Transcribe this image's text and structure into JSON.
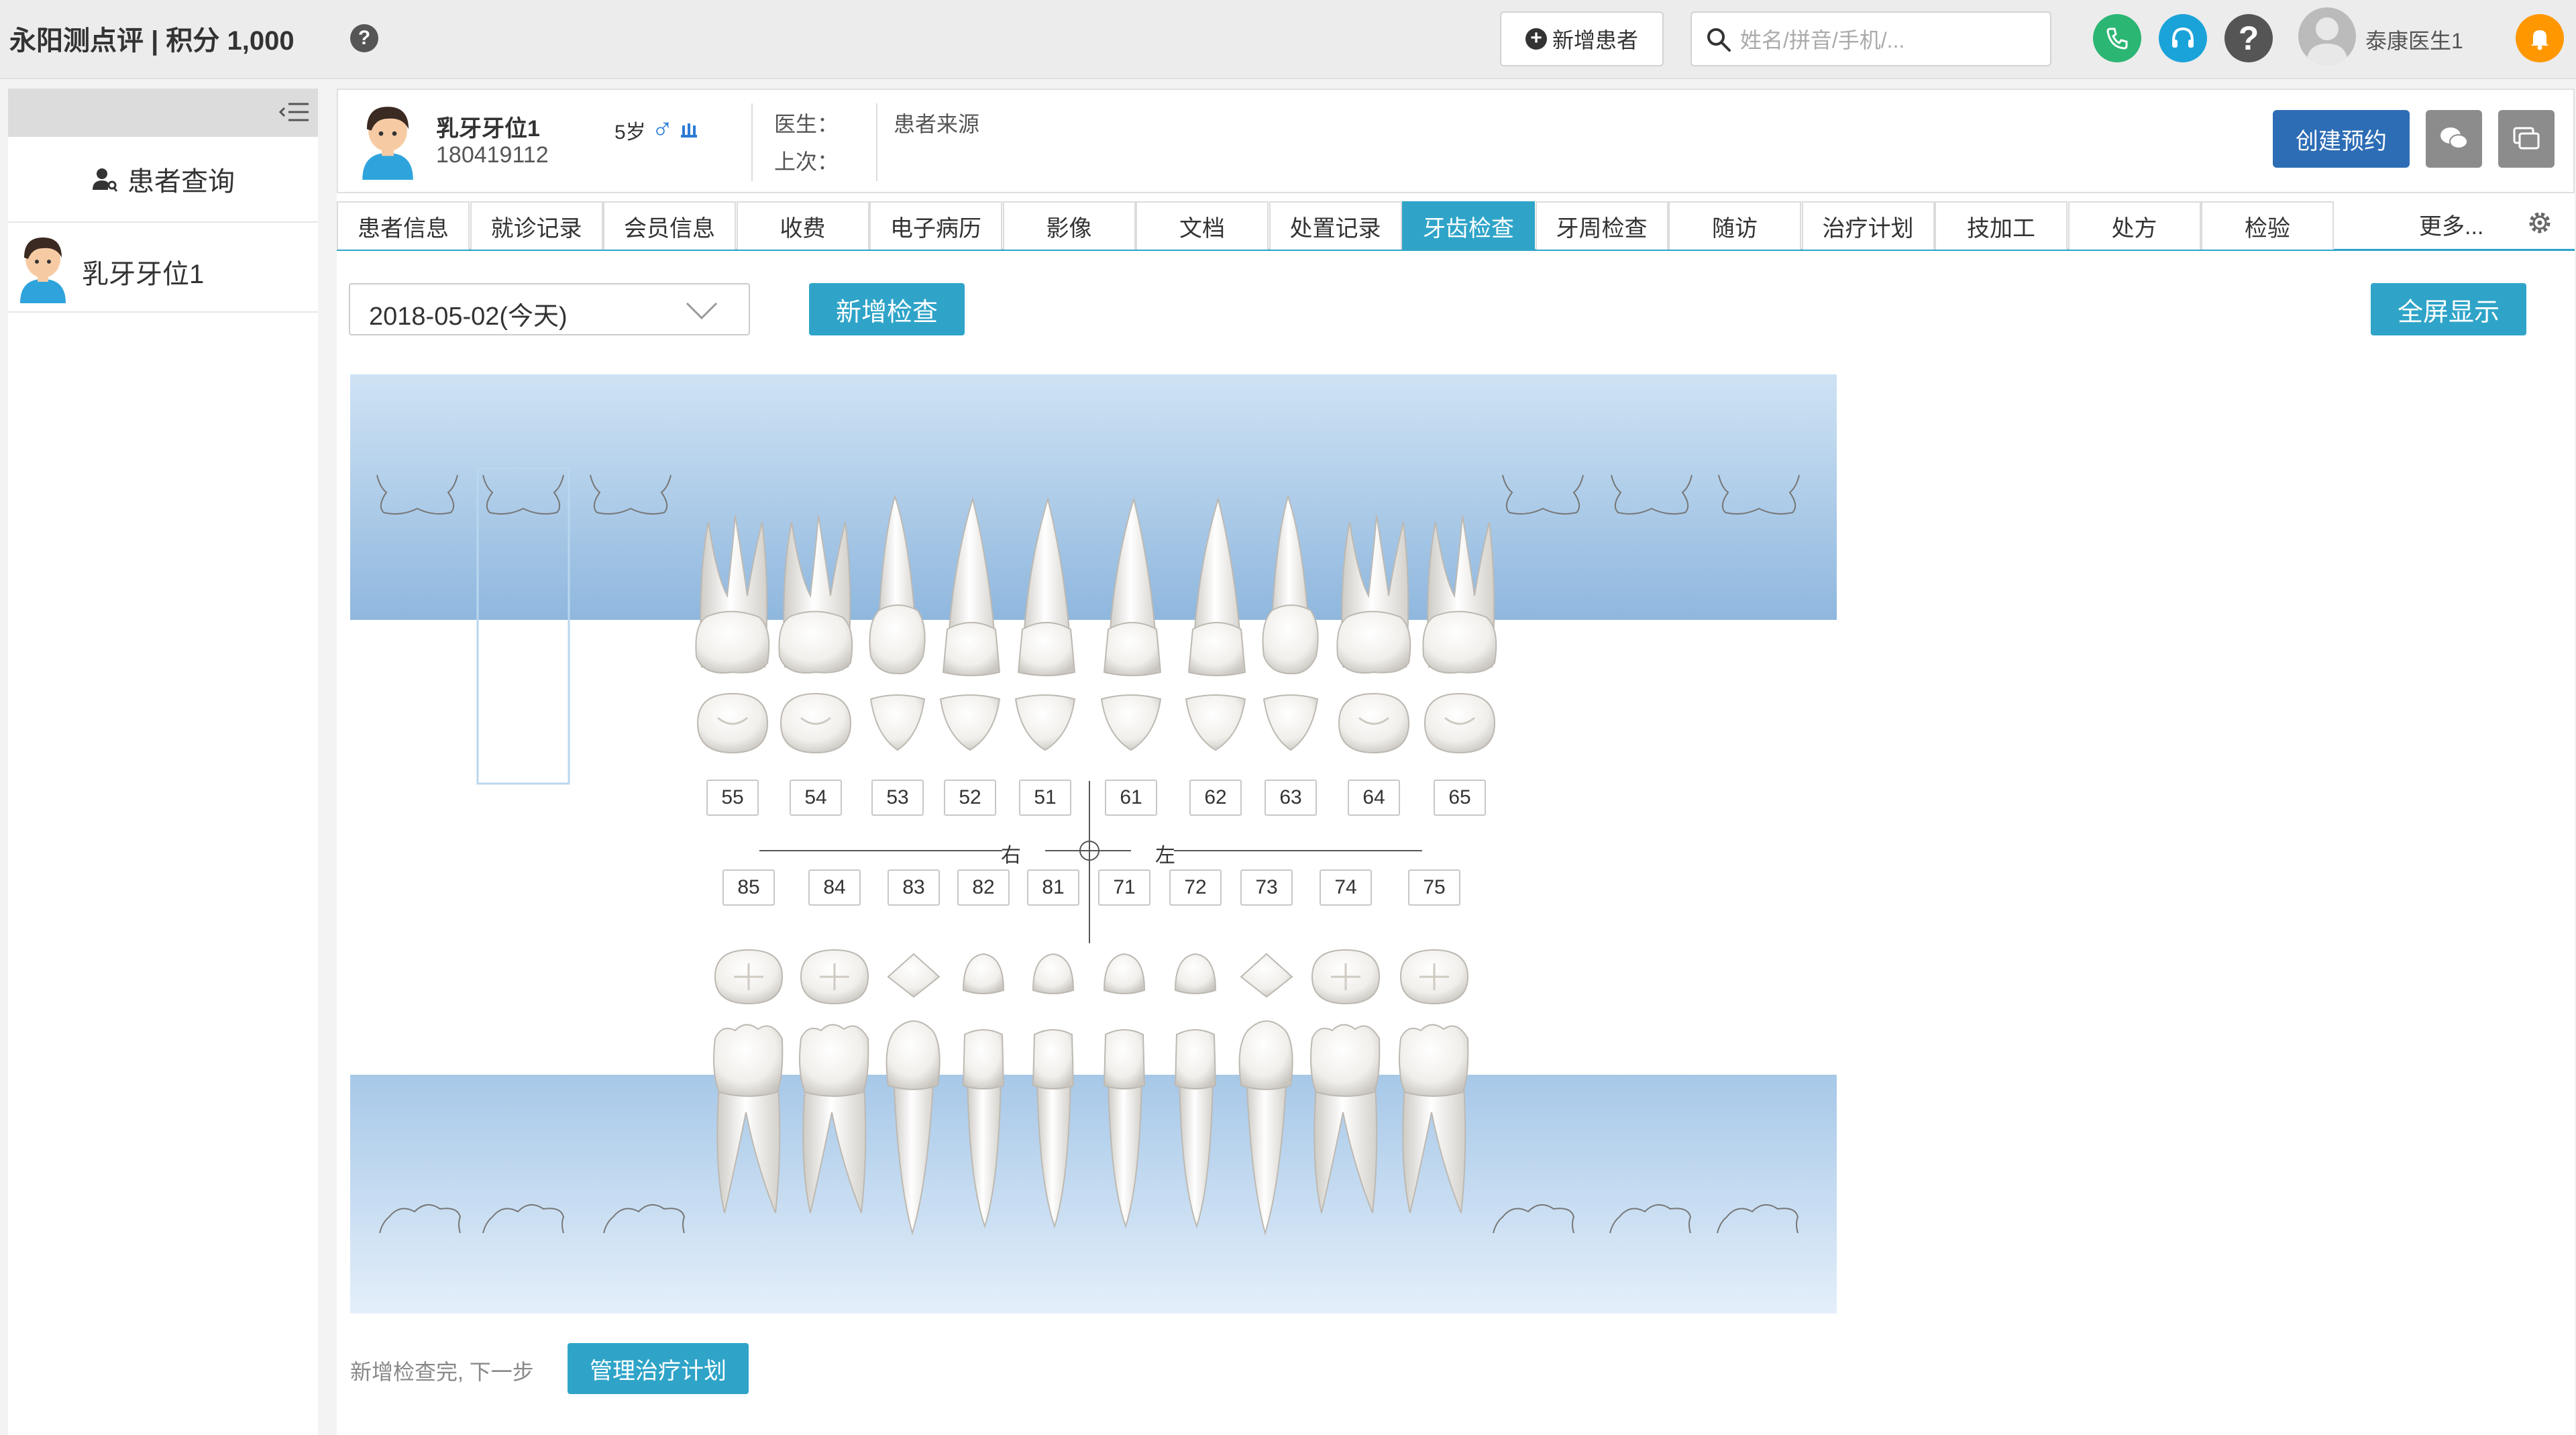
{
  "topbar": {
    "app_title": "永阳测点评 | 积分 1,000",
    "new_patient_label": "新增患者",
    "search_placeholder": "姓名/拼音/手机/...",
    "user_name": "泰康医生1"
  },
  "sidebar": {
    "patient_query_label": "患者查询",
    "patient_name": "乳牙牙位1"
  },
  "patient": {
    "name": "乳牙牙位1",
    "id": "180419112",
    "age": "5岁",
    "doctor_label": "医生：",
    "last_visit_label": "上次：",
    "source_label": "患者来源",
    "create_appointment_label": "创建预约"
  },
  "tabs": [
    {
      "label": "患者信息"
    },
    {
      "label": "就诊记录"
    },
    {
      "label": "会员信息"
    },
    {
      "label": "收费"
    },
    {
      "label": "电子病历"
    },
    {
      "label": "影像"
    },
    {
      "label": "文档"
    },
    {
      "label": "处置记录"
    },
    {
      "label": "牙齿检查",
      "active": true
    },
    {
      "label": "牙周检查"
    },
    {
      "label": "随访"
    },
    {
      "label": "治疗计划"
    },
    {
      "label": "技加工"
    },
    {
      "label": "处方"
    },
    {
      "label": "检验"
    }
  ],
  "more_label": "更多...",
  "exam": {
    "date_value": "2018-05-02(今天)",
    "new_exam_label": "新增检查",
    "fullscreen_label": "全屏显示"
  },
  "dental_chart": {
    "upper_teeth": [
      "55",
      "54",
      "53",
      "52",
      "51",
      "61",
      "62",
      "63",
      "64",
      "65"
    ],
    "lower_teeth": [
      "85",
      "84",
      "83",
      "82",
      "81",
      "71",
      "72",
      "73",
      "74",
      "75"
    ],
    "right_label": "右",
    "left_label": "左"
  },
  "footer": {
    "next_step_text": "新增检查完, 下一步",
    "manage_plan_label": "管理治疗计划"
  },
  "colors": {
    "accent": "#2fa4c8",
    "primary_button": "#2d6db5",
    "gum_gradient_top": "#cfe3f4",
    "gum_gradient_bottom": "#8fb7de"
  }
}
